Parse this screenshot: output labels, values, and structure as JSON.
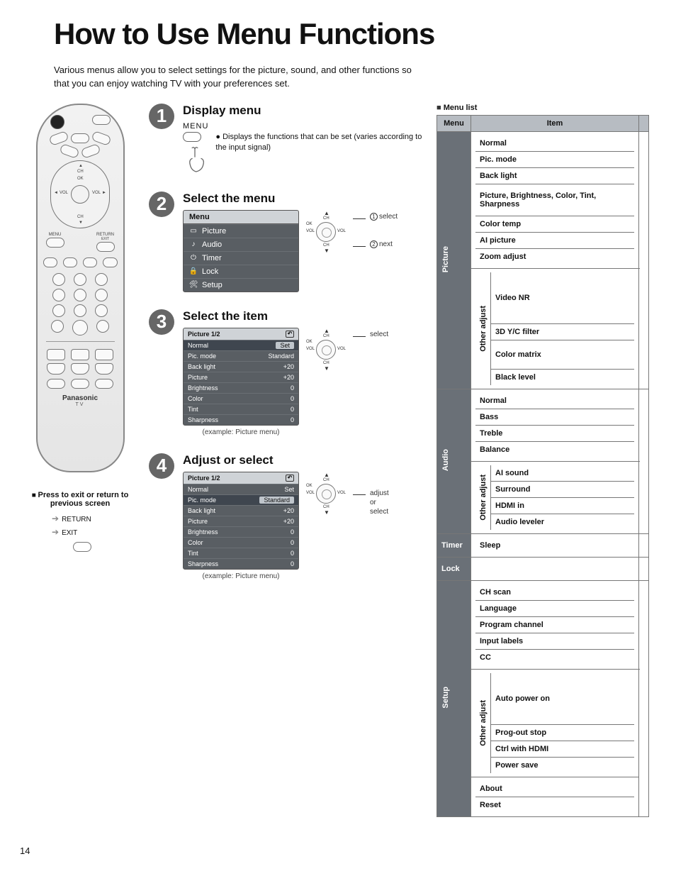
{
  "title": "How to Use Menu Functions",
  "intro": "Various menus allow you to select settings for the picture, sound, and other functions so that you can enjoy watching TV with your preferences set.",
  "page_number": "14",
  "remote": {
    "brand": "Panasonic",
    "subbrand": "TV",
    "nav_labels": {
      "up_icon": "▲",
      "down_icon": "▼",
      "ch": "CH",
      "ok": "OK",
      "vol_l": "VOL",
      "vol_r": "VOL",
      "left": "◄",
      "right": "►",
      "menu": "MENU",
      "return": "RETURN",
      "exit": "EXIT"
    }
  },
  "exit_note": {
    "heading": "Press to exit or return to previous screen",
    "line1": "RETURN",
    "line2": "EXIT"
  },
  "steps": [
    {
      "num": "1",
      "head": "Display menu",
      "menu_label": "MENU",
      "desc": "Displays the functions that can be set (varies according to the input signal)"
    },
    {
      "num": "2",
      "head": "Select the menu",
      "panel_header": "Menu",
      "panel_items": [
        "Picture",
        "Audio",
        "Timer",
        "Lock",
        "Setup"
      ],
      "annot1": "select",
      "annot2": "next",
      "num1": "1",
      "num2": "2"
    },
    {
      "num": "3",
      "head": "Select the item",
      "panel_title": "Picture   1/2",
      "panel_rows": [
        {
          "name": "Normal",
          "val": "Set",
          "sel": true
        },
        {
          "name": "Pic. mode",
          "val": "Standard"
        },
        {
          "name": "Back light",
          "val": "+20"
        },
        {
          "name": "Picture",
          "val": "+20"
        },
        {
          "name": "Brightness",
          "val": "0"
        },
        {
          "name": "Color",
          "val": "0"
        },
        {
          "name": "Tint",
          "val": "0"
        },
        {
          "name": "Sharpness",
          "val": "0"
        }
      ],
      "caption": "(example: Picture menu)",
      "annot": "select"
    },
    {
      "num": "4",
      "head": "Adjust or select",
      "panel_title": "Picture   1/2",
      "panel_rows": [
        {
          "name": "Normal",
          "val": "Set"
        },
        {
          "name": "Pic. mode",
          "val": "Standard",
          "sel": true
        },
        {
          "name": "Back light",
          "val": "+20"
        },
        {
          "name": "Picture",
          "val": "+20"
        },
        {
          "name": "Brightness",
          "val": "0"
        },
        {
          "name": "Color",
          "val": "0"
        },
        {
          "name": "Tint",
          "val": "0"
        },
        {
          "name": "Sharpness",
          "val": "0"
        }
      ],
      "caption": "(example: Picture menu)",
      "annot": "adjust or select"
    }
  ],
  "nav_mini": {
    "ch": "CH",
    "ok": "OK",
    "vol": "VOL",
    "up": "▲",
    "down": "▼"
  },
  "menu_list": {
    "heading": "Menu list",
    "th_menu": "Menu",
    "th_item": "Item",
    "other_adjust_label": "Other adjust",
    "sections": {
      "picture": {
        "label": "Picture",
        "items": [
          "Normal",
          "Pic. mode",
          "Back light",
          "Picture, Brightness, Color, Tint, Sharpness",
          "Color temp",
          "AI picture",
          "Zoom adjust"
        ],
        "other": [
          "Video NR",
          "3D Y/C filter",
          "Color matrix",
          "Black level"
        ]
      },
      "audio": {
        "label": "Audio",
        "items": [
          "Normal",
          "Bass",
          "Treble",
          "Balance"
        ],
        "other": [
          "AI sound",
          "Surround",
          "HDMI in",
          "Audio leveler"
        ]
      },
      "timer": {
        "label": "Timer",
        "items": [
          "Sleep"
        ]
      },
      "lock": {
        "label": "Lock",
        "items": [
          ""
        ]
      },
      "setup": {
        "label": "Setup",
        "items": [
          "CH scan",
          "Language",
          "Program channel",
          "Input labels",
          "CC"
        ],
        "other": [
          "Auto power on",
          "Prog-out stop",
          "Ctrl with HDMI",
          "Power save"
        ],
        "after": [
          "About",
          "Reset"
        ]
      }
    }
  }
}
